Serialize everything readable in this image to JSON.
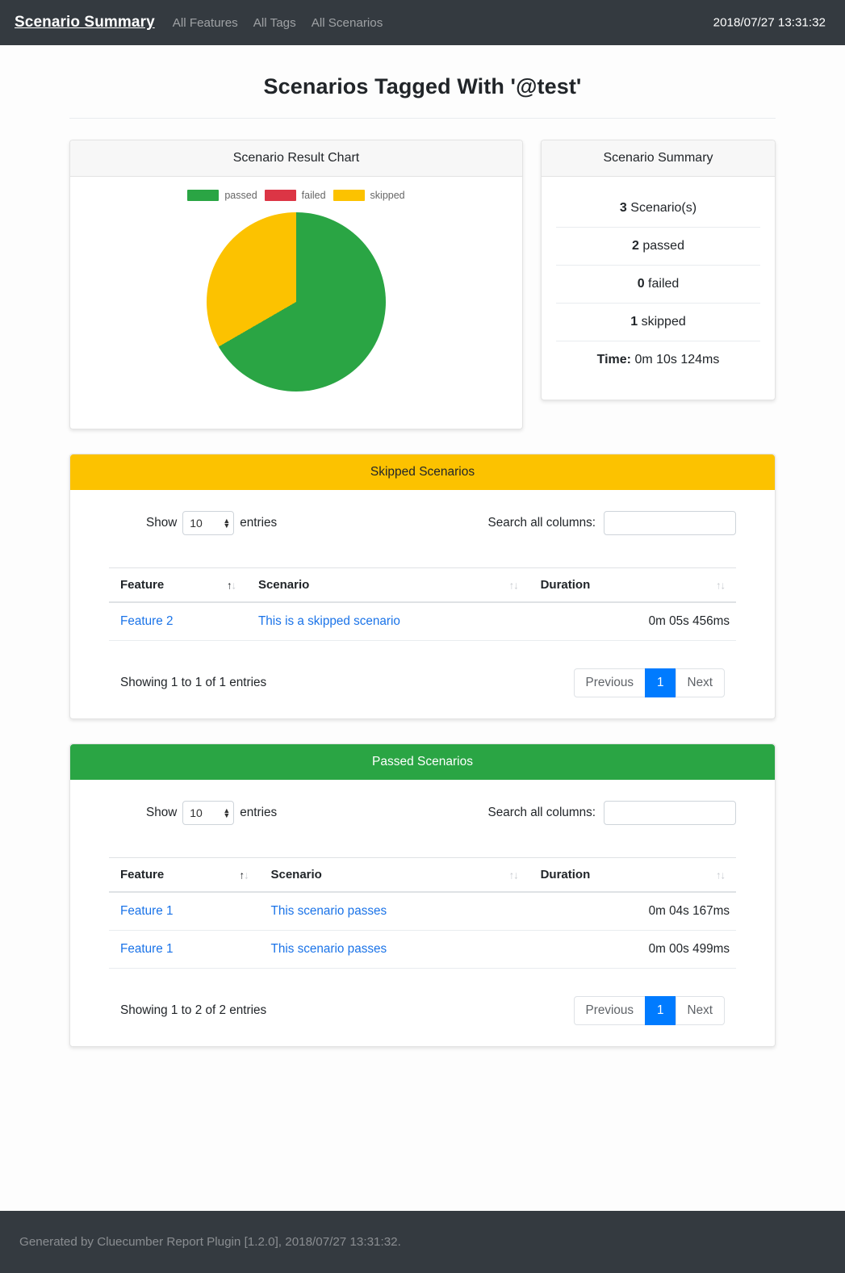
{
  "navbar": {
    "brand": "Scenario Summary",
    "links": [
      {
        "label": "All Features"
      },
      {
        "label": "All Tags"
      },
      {
        "label": "All Scenarios"
      }
    ],
    "timestamp": "2018/07/27 13:31:32"
  },
  "page": {
    "title": "Scenarios Tagged With '@test'"
  },
  "chart_card": {
    "title": "Scenario Result Chart"
  },
  "chart_data": {
    "type": "pie",
    "title": "Scenario Result Chart",
    "categories": [
      "passed",
      "failed",
      "skipped"
    ],
    "values": [
      2,
      0,
      1
    ],
    "colors": [
      "#2aa544",
      "#dc3545",
      "#fcc200"
    ],
    "legend_position": "top",
    "legend": [
      {
        "label": "passed",
        "color": "#2aa544",
        "value": 2
      },
      {
        "label": "failed",
        "color": "#dc3545",
        "value": 0
      },
      {
        "label": "skipped",
        "color": "#fcc200",
        "value": 1
      }
    ],
    "start_angle_deg": 0,
    "slices": [
      {
        "label": "passed",
        "percent": 66.67,
        "color": "#2aa544"
      },
      {
        "label": "skipped",
        "percent": 33.33,
        "color": "#fcc200"
      }
    ]
  },
  "summary_card": {
    "title": "Scenario Summary",
    "rows": [
      {
        "value": "3",
        "label": " Scenario(s)"
      },
      {
        "value": "2",
        "label": " passed"
      },
      {
        "value": "0",
        "label": " failed"
      },
      {
        "value": "1",
        "label": " skipped"
      },
      {
        "value": "Time:",
        "label": " 0m 10s 124ms"
      }
    ]
  },
  "tables": [
    {
      "title": "Skipped Scenarios",
      "length_prefix": "Show",
      "length_value": "10",
      "length_suffix": "entries",
      "filter_label": "Search all columns:",
      "filter_value": "",
      "filter_placeholder": "",
      "columns": [
        "Feature",
        "Scenario",
        "Duration"
      ],
      "rows": [
        {
          "feature": "Feature 2",
          "scenario": "This is a skipped scenario",
          "duration": "0m 05s 456ms"
        }
      ],
      "info": "Showing 1 to 1 of 1 entries",
      "pagination": {
        "previous": "Previous",
        "page": "1",
        "next": "Next"
      }
    },
    {
      "title": "Passed Scenarios",
      "length_prefix": "Show",
      "length_value": "10",
      "length_suffix": "entries",
      "filter_label": "Search all columns:",
      "filter_value": "",
      "filter_placeholder": "",
      "columns": [
        "Feature",
        "Scenario",
        "Duration"
      ],
      "rows": [
        {
          "feature": "Feature 1",
          "scenario": "This scenario passes",
          "duration": "0m 04s 167ms"
        },
        {
          "feature": "Feature 1",
          "scenario": "This scenario passes",
          "duration": "0m 00s 499ms"
        }
      ],
      "info": "Showing 1 to 2 of 2 entries",
      "pagination": {
        "previous": "Previous",
        "page": "1",
        "next": "Next"
      }
    }
  ],
  "footer": {
    "text": "Generated by Cluecumber Report Plugin [1.2.0], 2018/07/27 13:31:32."
  }
}
